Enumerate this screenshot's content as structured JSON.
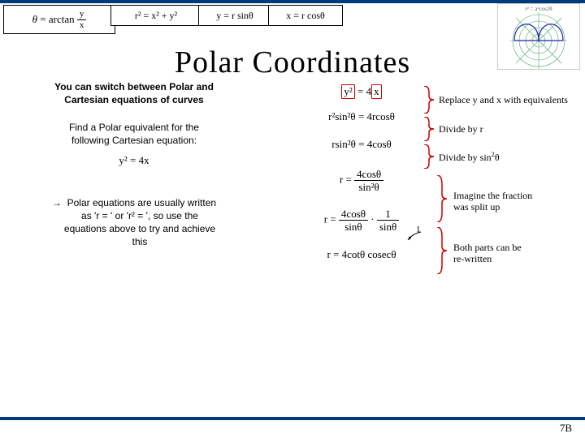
{
  "title": "Polar Coordinates",
  "formulas": {
    "theta": "θ = arctan( y⁄x )",
    "r2": "r² = x² + y²",
    "y": "y = r sinθ",
    "x": "x = r cosθ"
  },
  "left": {
    "heading_l1": "You can switch between Polar and",
    "heading_l2": "Cartesian equations of curves",
    "sub_l1": "Find a Polar equivalent for the",
    "sub_l2": "following Cartesian equation:",
    "given_eq": "y² = 4x",
    "arrow": "→",
    "bullet_l1": "Polar equations are usually written",
    "bullet_l2": "as 'r = ' or 'r² = ', so use the",
    "bullet_l3": "equations above to try and achieve",
    "bullet_l4": "this"
  },
  "steps": {
    "s1_lhs_box": "y²",
    "s1_mid": " = 4",
    "s1_rhs_box": "x",
    "s2": "r²sin²θ = 4rcosθ",
    "s3": "rsin²θ = 4cosθ",
    "s4_lhs": "r = ",
    "s4_num": "4cosθ",
    "s4_den": "sin²θ",
    "s5_lhs": "r = ",
    "s5a_num": "4cosθ",
    "s5a_den": "sinθ",
    "s5_dot": " · ",
    "s5b_num": "1",
    "s5b_den": "sinθ",
    "s6": "r = 4cotθ cosecθ"
  },
  "annotations": {
    "a1": "Replace y and x with equivalents",
    "a2": "Divide by r",
    "a3_pre": "Divide by sin",
    "a3_sup": "2",
    "a3_post": "θ",
    "a4_l1": "Imagine the fraction",
    "a4_l2": "was split up",
    "a5_l1": "Both parts can be",
    "a5_l2": "re-written",
    "one": "1"
  },
  "thumb": {
    "eq": "r² = a²cos2θ"
  },
  "pagenum": "7B"
}
